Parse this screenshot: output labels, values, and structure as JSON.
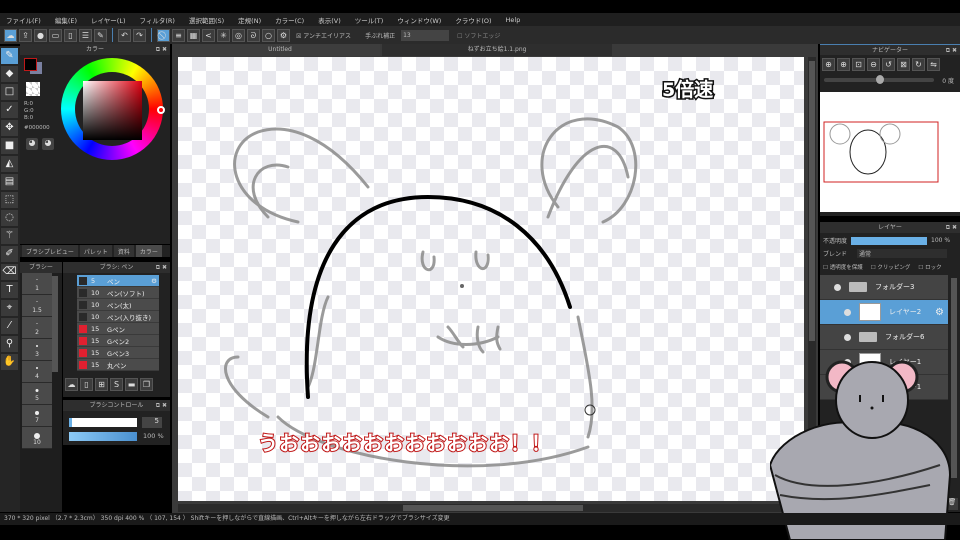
{
  "menu": [
    "ファイル(F)",
    "編集(E)",
    "レイヤー(L)",
    "フィルタ(R)",
    "選択範囲(S)",
    "定規(N)",
    "カラー(C)",
    "表示(V)",
    "ツール(T)",
    "ウィンドウ(W)",
    "クラウド(O)",
    "Help"
  ],
  "toolbar": {
    "antialias": "アンチエイリアス",
    "stabilizer_label": "手ぶれ補正",
    "stabilizer_value": "13",
    "soft_edge": "ソフトエッジ"
  },
  "color_panel": {
    "title": "カラー",
    "r": "R:0",
    "g": "G:0",
    "b": "B:0",
    "hex": "#000000",
    "accent": "#5a9fd6"
  },
  "panel_tabs": [
    "ブラシプレビュー",
    "パレット",
    "資料",
    "カラー"
  ],
  "brush_sizes": {
    "title": "ブラシー",
    "items": [
      "1",
      "1.5",
      "2",
      "3",
      "4",
      "5",
      "7",
      "10"
    ]
  },
  "brush_panel": {
    "title": "ブラシ: ペン",
    "items": [
      {
        "size": "5",
        "name": "ペン",
        "color": "#2a2a2a"
      },
      {
        "size": "10",
        "name": "ペン(ソフト)",
        "color": "#2a2a2a"
      },
      {
        "size": "10",
        "name": "ペン(太)",
        "color": "#2a2a2a"
      },
      {
        "size": "10",
        "name": "ペン(入り抜き)",
        "color": "#2a2a2a"
      },
      {
        "size": "15",
        "name": "Gペン",
        "color": "#e02030"
      },
      {
        "size": "15",
        "name": "Gペン2",
        "color": "#e02030"
      },
      {
        "size": "15",
        "name": "Gペン3",
        "color": "#e02030"
      },
      {
        "size": "15",
        "name": "丸ペン",
        "color": "#e02030"
      }
    ]
  },
  "brush_control": {
    "title": "ブラシコントロール",
    "size": "5",
    "opacity": "100 %",
    "size_fraction": 0.05,
    "opacity_fraction": 1.0
  },
  "canvas_tabs": [
    "Untitled",
    "ねずお立ち絵1.1.png"
  ],
  "overlay": {
    "speed": "5倍速",
    "subtitle": "うおおおおおおおおおおお！！"
  },
  "navigator": {
    "title": "ナビゲーター",
    "angle": "0 度"
  },
  "layers": {
    "title": "レイヤー",
    "opacity_label": "不透明度",
    "opacity": "100 %",
    "blend_label": "ブレンド",
    "blend": "通常",
    "protect": "透明度を保護",
    "clipping": "クリッピング",
    "lock": "ロック",
    "items": [
      {
        "name": "フォルダー3",
        "type": "folder"
      },
      {
        "name": "レイヤー2",
        "type": "layer",
        "selected": true
      },
      {
        "name": "フォルダー6",
        "type": "folder"
      },
      {
        "name": "レイヤー1",
        "type": "layer"
      },
      {
        "name": "レイヤー1",
        "type": "layer"
      }
    ]
  },
  "status": "370 * 320 pixel （2.7 * 2.3cm） 350 dpi  400 %  （ 107, 154 ）  Shiftキーを押しながらで直線描画、Ctrl+Altキーを押しながら左右ドラッグでブラシサイズ変更"
}
